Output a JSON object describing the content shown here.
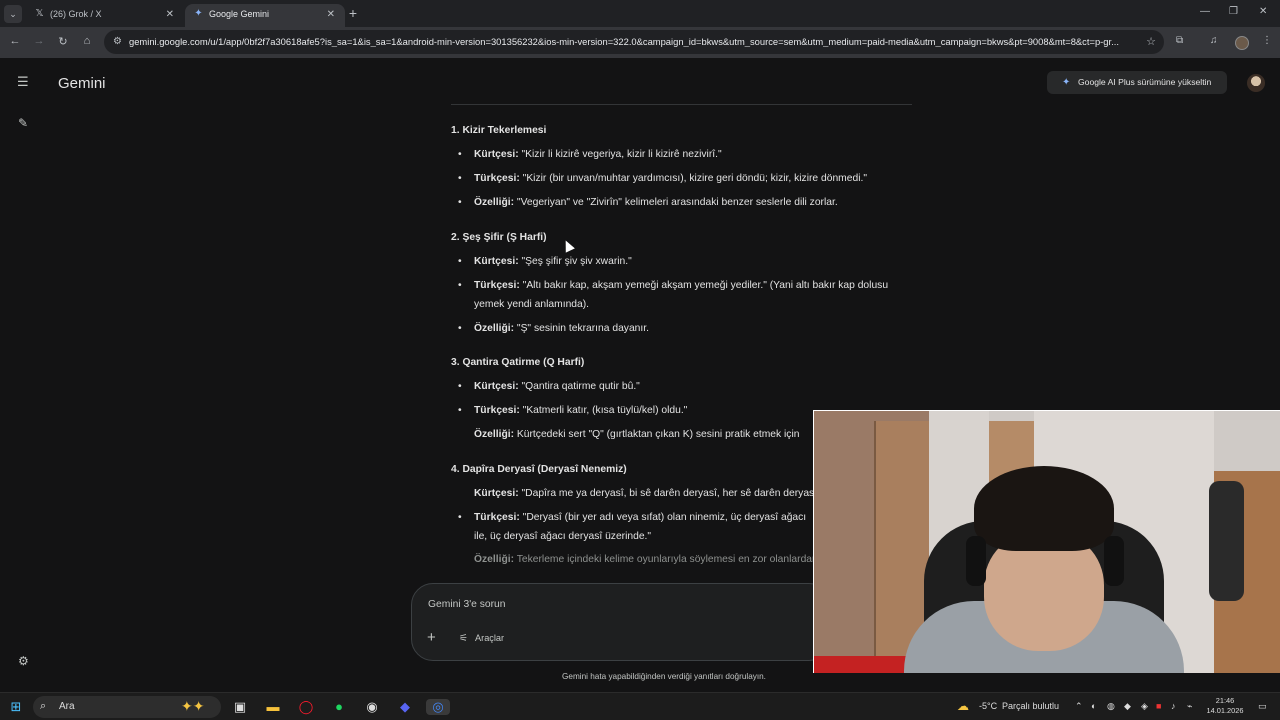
{
  "browser": {
    "tabs": [
      {
        "favicon": "x-logo-icon",
        "label": "(26) Grok / X"
      },
      {
        "favicon": "gemini-spark-icon",
        "label": "Google Gemini"
      }
    ],
    "url": "gemini.google.com/u/1/app/0bf2f7a30618afe5?is_sa=1&is_sa=1&android-min-version=301356232&ios-min-version=322.0&campaign_id=bkws&utm_source=sem&utm_medium=paid-media&utm_campaign=bkws&pt=9008&mt=8&ct=p-gr..."
  },
  "gemini": {
    "title": "Gemini",
    "upgrade_label": "Google AI Plus sürümüne yükseltin",
    "sections": [
      {
        "heading": "1. Kizir Tekerlemesi",
        "items": [
          {
            "key": "Kürtçesi:",
            "text": " \"Kizir li kizirê vegeriya, kizir li kizirê nezivirî.\""
          },
          {
            "key": "Türkçesi:",
            "text": " \"Kizir (bir unvan/muhtar yardımcısı), kizire geri döndü; kizir, kizire dönmedi.\""
          },
          {
            "key": "Özelliği:",
            "text": " \"Vegeriyan\" ve \"Zivirîn\" kelimeleri arasındaki benzer seslerle dili zorlar."
          }
        ]
      },
      {
        "heading": "2. Şeş Şifir (Ş Harfi)",
        "items": [
          {
            "key": "Kürtçesi:",
            "text": " \"Şeş şifir şiv şiv xwarin.\""
          },
          {
            "key": "Türkçesi:",
            "text": " \"Altı bakır kap, akşam yemeği akşam yemeği yediler.\" (Yani altı bakır kap dolusu yemek yendi anlamında)."
          },
          {
            "key": "Özelliği:",
            "text": " \"Ş\" sesinin tekrarına dayanır."
          }
        ]
      },
      {
        "heading": "3. Qantira Qatirme (Q Harfi)",
        "items": [
          {
            "key": "Kürtçesi:",
            "text": " \"Qantira qatirme qutir bû.\""
          },
          {
            "key": "Türkçesi:",
            "text": " \"Katmerli katır, (kısa tüylü/kel) oldu.\""
          },
          {
            "key": "Özelliği:",
            "text": " Kürtçedeki sert \"Q\" (gırtlaktan çıkan K) sesini pratik etmek için"
          }
        ]
      },
      {
        "heading": "4. Dapîra Deryasî (Deryasî Nenemiz)",
        "items": [
          {
            "key": "Kürtçesi:",
            "text": " \"Dapîra me ya deryasî, bi sê darên deryasî, her sê darên deryasî\""
          },
          {
            "key": "Türkçesi:",
            "text": " \"Deryasî (bir yer adı veya sıfat) olan ninemiz, üç deryasî ağacı ile, üç deryasî ağacı deryasî üzerinde.\""
          },
          {
            "key": "Özelliği:",
            "text": " Tekerleme içindeki kelime oyunlarıyla söylemesi en zor olanlardan"
          }
        ]
      }
    ],
    "composer": {
      "placeholder": "Gemini 3'e sorun",
      "tools_label": "Araçlar"
    },
    "disclaimer": "Gemini hata yapabildiğinden verdiği yanıtları doğrulayın."
  },
  "taskbar": {
    "search_placeholder": "Ara",
    "weather_temp": "-5°C",
    "weather_desc": "Parçalı bulutlu",
    "time": "21:46",
    "date": "14.01.2026"
  }
}
